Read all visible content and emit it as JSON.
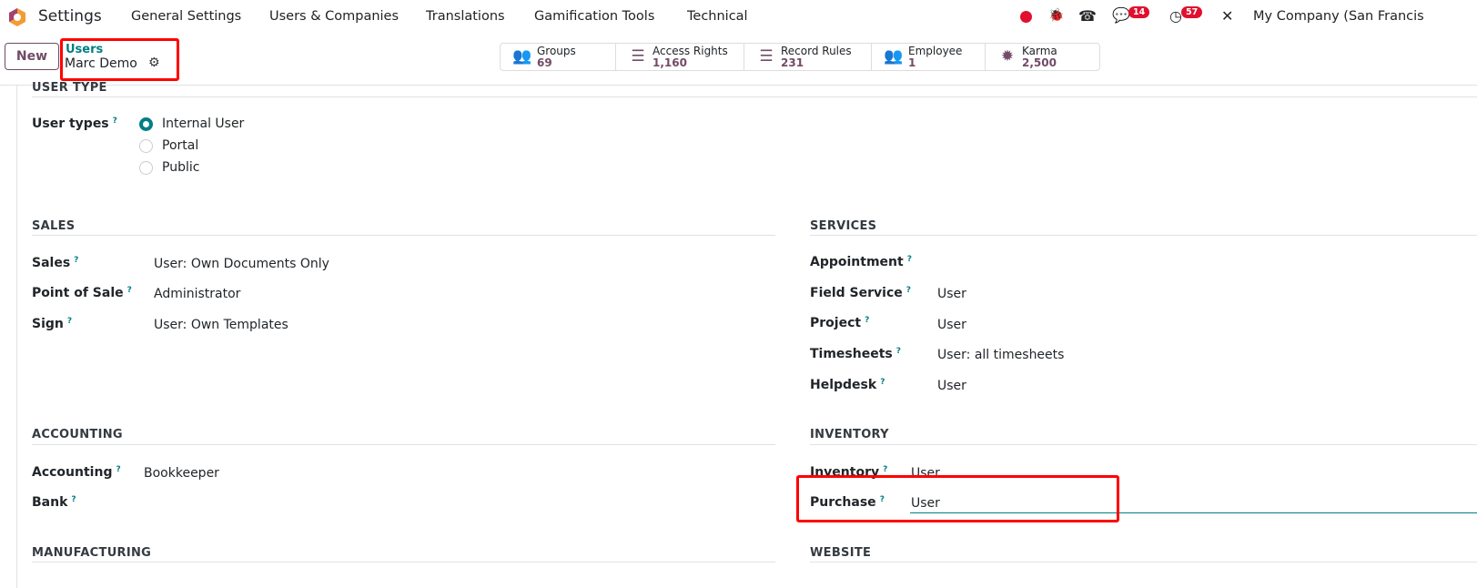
{
  "topbar": {
    "app": "Settings",
    "menu": [
      "General Settings",
      "Users & Companies",
      "Translations",
      "Gamification Tools",
      "Technical"
    ],
    "messages_count": "14",
    "activities_count": "57",
    "company": "My Company (San Francis"
  },
  "control": {
    "new_label": "New",
    "breadcrumb": "Users",
    "record": "Marc Demo"
  },
  "stats": [
    {
      "label": "Groups",
      "value": "69",
      "icon": "users-icon"
    },
    {
      "label": "Access Rights",
      "value": "1,160",
      "icon": "list-icon"
    },
    {
      "label": "Record Rules",
      "value": "231",
      "icon": "list-icon"
    },
    {
      "label": "Employee",
      "value": "1",
      "icon": "users-icon"
    },
    {
      "label": "Karma",
      "value": "2,500",
      "icon": "badge-icon"
    }
  ],
  "user_type": {
    "title": "USER TYPE",
    "label": "User types",
    "options": [
      "Internal User",
      "Portal",
      "Public"
    ],
    "selected": "Internal User"
  },
  "sales": {
    "title": "SALES",
    "rows": [
      {
        "label": "Sales",
        "value": "User: Own Documents Only"
      },
      {
        "label": "Point of Sale",
        "value": "Administrator"
      },
      {
        "label": "Sign",
        "value": "User: Own Templates"
      }
    ]
  },
  "services": {
    "title": "SERVICES",
    "rows": [
      {
        "label": "Appointment",
        "value": ""
      },
      {
        "label": "Field Service",
        "value": "User"
      },
      {
        "label": "Project",
        "value": "User"
      },
      {
        "label": "Timesheets",
        "value": "User: all timesheets"
      },
      {
        "label": "Helpdesk",
        "value": "User"
      }
    ]
  },
  "accounting": {
    "title": "ACCOUNTING",
    "rows": [
      {
        "label": "Accounting",
        "value": "Bookkeeper"
      },
      {
        "label": "Bank",
        "value": ""
      }
    ]
  },
  "inventory": {
    "title": "INVENTORY",
    "rows": [
      {
        "label": "Inventory",
        "value": "User"
      },
      {
        "label": "Purchase",
        "value": "User"
      }
    ]
  },
  "manufacturing": {
    "title": "MANUFACTURING"
  },
  "website": {
    "title": "WEBSITE"
  },
  "colors": {
    "accent": "#017e84",
    "brand": "#714b67",
    "highlight": "#ff0000"
  }
}
